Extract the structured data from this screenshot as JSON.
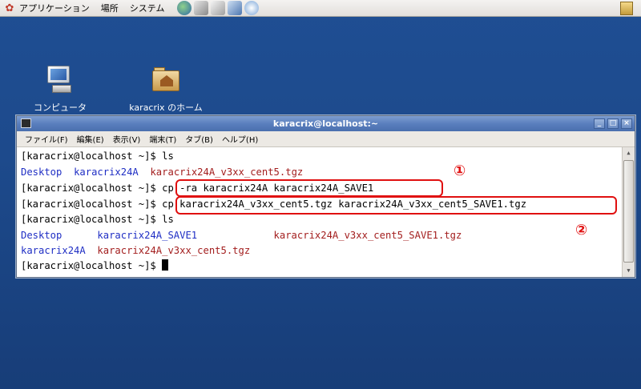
{
  "panel": {
    "menus": [
      "アプリケーション",
      "場所",
      "システム"
    ],
    "launchers": [
      "web-browser-icon",
      "mail-client-icon",
      "text-editor-icon",
      "presentation-icon",
      "network-icon"
    ],
    "notes_icon": "notes-icon"
  },
  "desktop": {
    "icons": [
      {
        "label": "コンピュータ",
        "icon": "computer-icon"
      },
      {
        "label": "karacrix のホーム",
        "icon": "home-folder-icon"
      }
    ]
  },
  "window": {
    "title": "karacrix@localhost:~",
    "menu": [
      "ファイル(F)",
      "編集(E)",
      "表示(V)",
      "端末(T)",
      "タブ(B)",
      "ヘルプ(H)"
    ],
    "terminal": {
      "prompt": "[karacrix@localhost ~]$",
      "lines": [
        {
          "cmd": " ls"
        },
        {
          "items": [
            "Desktop",
            "karacrix24A",
            "karacrix24A_v3xx_cent5.tgz"
          ]
        },
        {
          "cmd": " cp -ra karacrix24A karacrix24A_SAVE1"
        },
        {
          "cmd": " cp karacrix24A_v3xx_cent5.tgz karacrix24A_v3xx_cent5_SAVE1.tgz"
        },
        {
          "cmd": " ls"
        },
        {
          "items": [
            "Desktop",
            "karacrix24A_SAVE1",
            "karacrix24A_v3xx_cent5_SAVE1.tgz"
          ]
        },
        {
          "items": [
            "karacrix24A",
            "karacrix24A_v3xx_cent5.tgz"
          ]
        },
        {
          "cmd": " "
        }
      ]
    }
  },
  "annotations": {
    "marker1": "①",
    "marker2": "②",
    "color": "#e01010"
  }
}
